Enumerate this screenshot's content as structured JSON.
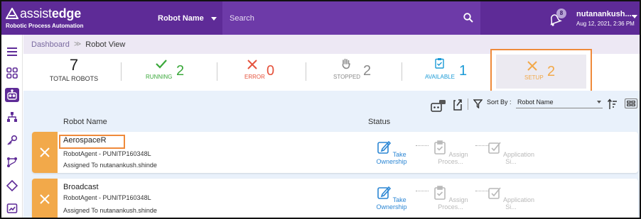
{
  "brand": {
    "name_light": "assist",
    "name_bold": "edge",
    "tagline": "Robotic Process Automation"
  },
  "header": {
    "selector_label": "Robot Name",
    "search_placeholder": "Search",
    "notification_count": "8",
    "user_name": "nutanankush....",
    "user_date": "Aug 12, 2021, 2:36 PM"
  },
  "breadcrumb": {
    "parent": "Dashboard",
    "separator": "≫",
    "current": "Robot View"
  },
  "stats": {
    "total": {
      "count": "7",
      "label": "TOTAL ROBOTS"
    },
    "running": {
      "count": "2",
      "label": "RUNNING"
    },
    "error": {
      "count": "0",
      "label": "ERROR"
    },
    "stopped": {
      "count": "2",
      "label": "STOPPED"
    },
    "available": {
      "count": "1",
      "label": "AVAILABLE"
    },
    "setup": {
      "count": "2",
      "label": "SETUP"
    }
  },
  "toolbar": {
    "sort_label": "Sort By :",
    "sort_value": "Robot Name"
  },
  "columns": {
    "name": "Robot Name",
    "status": "Status"
  },
  "robots": [
    {
      "name": "AerospaceR",
      "agent": "RobotAgent - PUNITP160348L",
      "assigned": "Assigned To nutanankush.shinde",
      "steps": [
        "Take Ownership",
        "Assign Proces...",
        "Application Si..."
      ]
    },
    {
      "name": "Broadcast",
      "agent": "RobotAgent - PUNITP160348L",
      "assigned": "Assigned To nutanankush.shinde",
      "steps": [
        "Take Ownership",
        "Assign Proces...",
        "Application Si..."
      ]
    }
  ],
  "colors": {
    "brand_purple": "#5e2b97",
    "running": "#3aa83a",
    "error": "#e5533d",
    "stopped": "#8a8a8a",
    "available": "#1a9ad6",
    "setup": "#f2a94a",
    "link_blue": "#2b86d4"
  },
  "icons": [
    "menu-icon",
    "grid-icon",
    "robot-icon",
    "hierarchy-icon",
    "key-icon",
    "flow-icon",
    "diamond-icon",
    "chart-icon",
    "search-icon",
    "bell-icon",
    "check-icon",
    "x-icon",
    "hand-icon",
    "clipboard-check-icon",
    "tools-icon",
    "filter-icon",
    "sort-icon",
    "card-view-icon",
    "edit-icon"
  ]
}
